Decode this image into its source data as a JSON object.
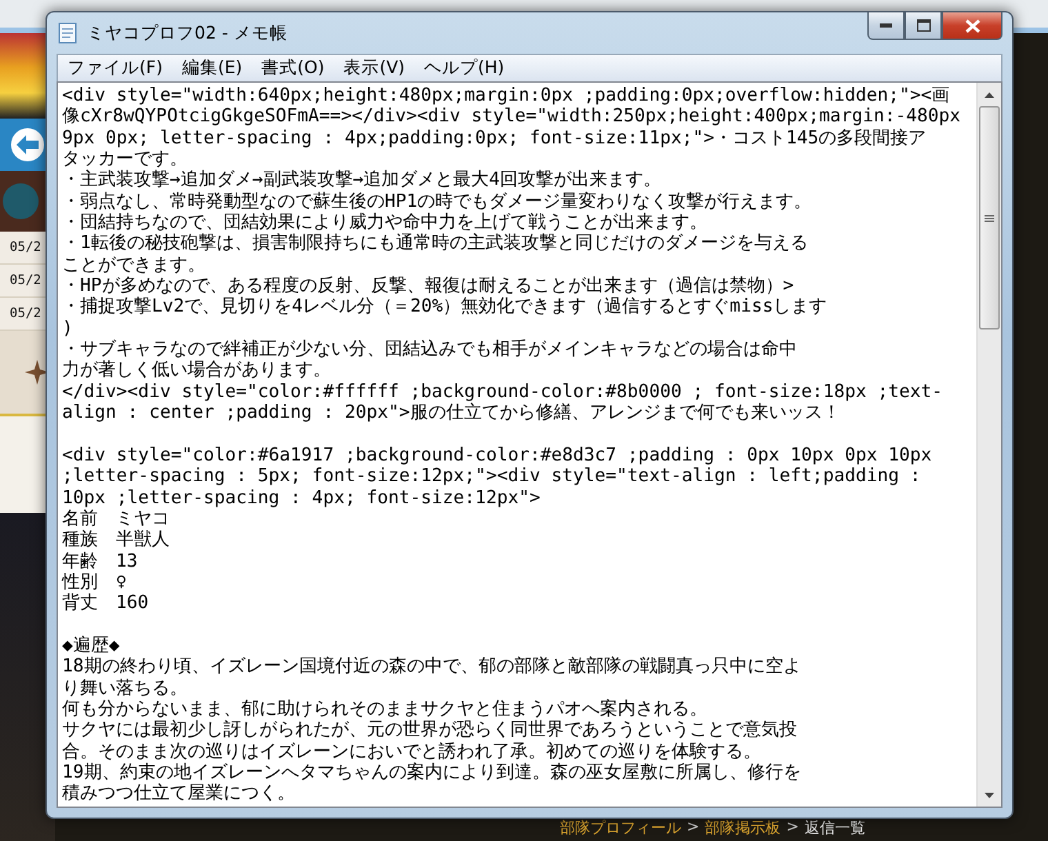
{
  "background_page": {
    "dates": [
      "05/2",
      "05/2",
      "05/2"
    ],
    "breadcrumb": {
      "separator": ">",
      "items": [
        {
          "label": "部隊プロフィール",
          "current": false
        },
        {
          "label": "部隊掲示板",
          "current": false
        },
        {
          "label": "返信一覧",
          "current": true
        }
      ]
    }
  },
  "window": {
    "title": "ミヤコプロフ02 - メモ帳"
  },
  "menu": [
    "ファイル(F)",
    "編集(E)",
    "書式(O)",
    "表示(V)",
    "ヘルプ(H)"
  ],
  "editor": {
    "blocks": [
      {
        "lines": [
          "<div style=\"width:640px;height:480px;margin:0px ;padding:0px;overflow:hidden;\"><画",
          "像cXr8wQYPOtcigGkgeSOFmA==></div><div style=\"width:250px;height:400px;margin:-480px",
          "9px 0px; letter-spacing : 4px;padding:0px; font-size:11px;\">・コスト145の多段間接ア",
          "タッカーです。",
          "・主武装攻撃→追加ダメ→副武装攻撃→追加ダメと最大4回攻撃が出来ます。",
          "・弱点なし、常時発動型なので蘇生後のHP1の時でもダメージ量変わりなく攻撃が行えます。",
          "・団結持ちなので、団結効果により威力や命中力を上げて戦うことが出来ます。",
          "・1転後の秘技砲撃は、損害制限持ちにも通常時の主武装攻撃と同じだけのダメージを与える",
          "ことができます。",
          "・HPが多めなので、ある程度の反射、反撃、報復は耐えることが出来ます（過信は禁物）>",
          "・捕捉攻撃Lv2で、見切りを4レベル分（＝20%）無効化できます（過信するとすぐmissします",
          ")",
          "・サブキャラなので絆補正が少ない分、団結込みでも相手がメインキャラなどの場合は命中",
          "力が著しく低い場合があります。",
          "</div><div style=\"color:#ffffff ;background-color:#8b0000 ; font-size:18px ;text-",
          "align : center ;padding : 20px\">服の仕立てから修繕、アレンジまで何でも来いッス！"
        ]
      },
      {
        "lines": [
          "<div style=\"color:#6a1917 ;background-color:#e8d3c7 ;padding : 0px 10px 0px 10px",
          ";letter-spacing : 5px; font-size:12px;\"><div style=\"text-align : left;padding :",
          "10px ;letter-spacing : 4px; font-size:12px\">",
          "名前　ミヤコ",
          "種族　半獣人",
          "年齢　13",
          "性別　♀",
          "背丈　160"
        ]
      },
      {
        "lines": [
          "◆遍歴◆",
          "18期の終わり頃、イズレーン国境付近の森の中で、郁の部隊と敵部隊の戦闘真っ只中に空よ",
          "り舞い落ちる。",
          "何も分からないまま、郁に助けられそのままサクヤと住まうパオへ案内される。",
          "サクヤには最初少し訝しがられたが、元の世界が恐らく同世界であろうということで意気投",
          "合。そのまま次の巡りはイズレーンにおいでと誘われ了承。初めての巡りを体験する。",
          "19期、約束の地イズレーンへタマちゃんの案内により到達。森の巫女屋敷に所属し、修行を",
          "積みつつ仕立て屋業につく。"
        ]
      }
    ]
  }
}
